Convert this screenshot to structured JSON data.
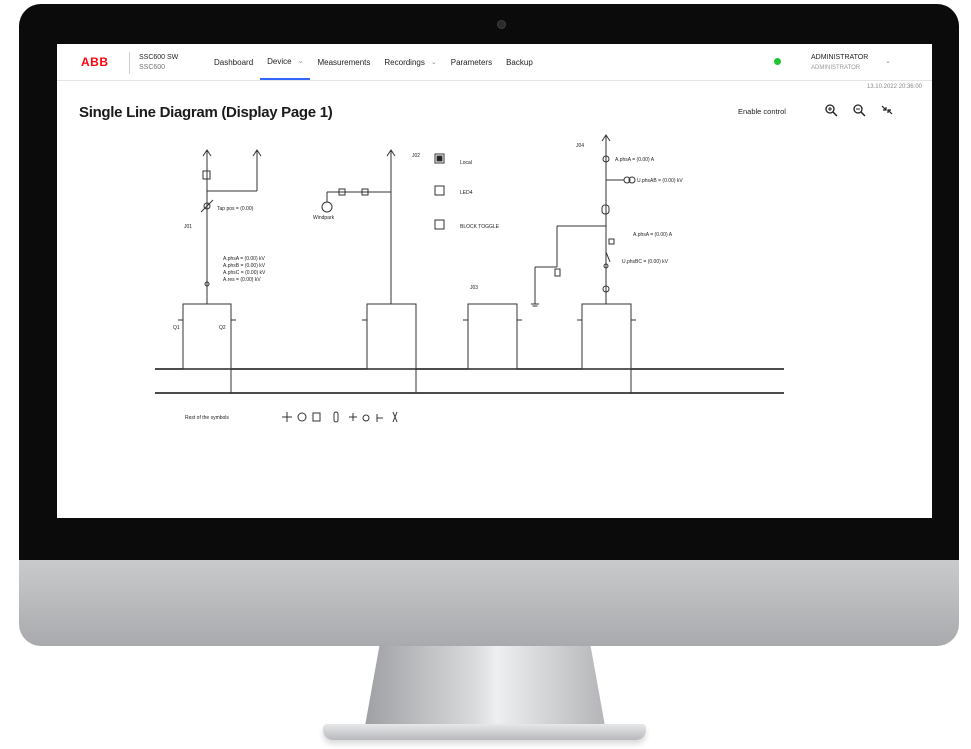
{
  "app": {
    "logo": "ABB",
    "device_name": "SSC600 SW",
    "device_sub": "SSC600"
  },
  "nav": {
    "items": [
      {
        "label": "Dashboard",
        "active": false,
        "dropdown": false
      },
      {
        "label": "Device",
        "active": true,
        "dropdown": true
      },
      {
        "label": "Measurements",
        "active": false,
        "dropdown": false
      },
      {
        "label": "Recordings",
        "active": false,
        "dropdown": true
      },
      {
        "label": "Parameters",
        "active": false,
        "dropdown": false
      },
      {
        "label": "Backup",
        "active": false,
        "dropdown": false
      }
    ]
  },
  "user": {
    "name": "ADMINISTRATOR",
    "role": "ADMINISTRATOR",
    "status_color": "#1ec432"
  },
  "datetime": "13.10.2022  20:36:00",
  "page": {
    "title": "Single Line Diagram (Display Page 1)",
    "enable_control": "Enable control"
  },
  "toolbar": {
    "zoom_in_icon": "zoom-in-icon",
    "zoom_out_icon": "zoom-out-icon",
    "fit_icon": "collapse-icon"
  },
  "diagram": {
    "labels": {
      "j01": "J01",
      "j02": "J02",
      "j03": "J03",
      "j04": "J04",
      "q1": "Q1",
      "q2": "Q2",
      "tap_pos": "Tap pos = (0.00)",
      "windpark": "Windpark",
      "meas_a": "A.phsA = (0.00) kV",
      "meas_b": "A.phsB = (0.00) kV",
      "meas_c": "A.phsC = (0.00) kV",
      "meas_res": "A.res = (0.00) kV",
      "local": "Local",
      "led4": "LED4",
      "block_toggle": "BLOCK TOGGLE",
      "j04_top": "A.phsA = (0.00) A",
      "j04_ab": "U.phsAB = (0.00) kV",
      "j04_mid": "A.phsA = (0.00) A",
      "j04_bc": "U.phsBC = (0.00) kV",
      "rest_symbols": "Rest of the symbols"
    }
  },
  "colors": {
    "accent": "#3366ff",
    "brand": "#ff000f"
  }
}
